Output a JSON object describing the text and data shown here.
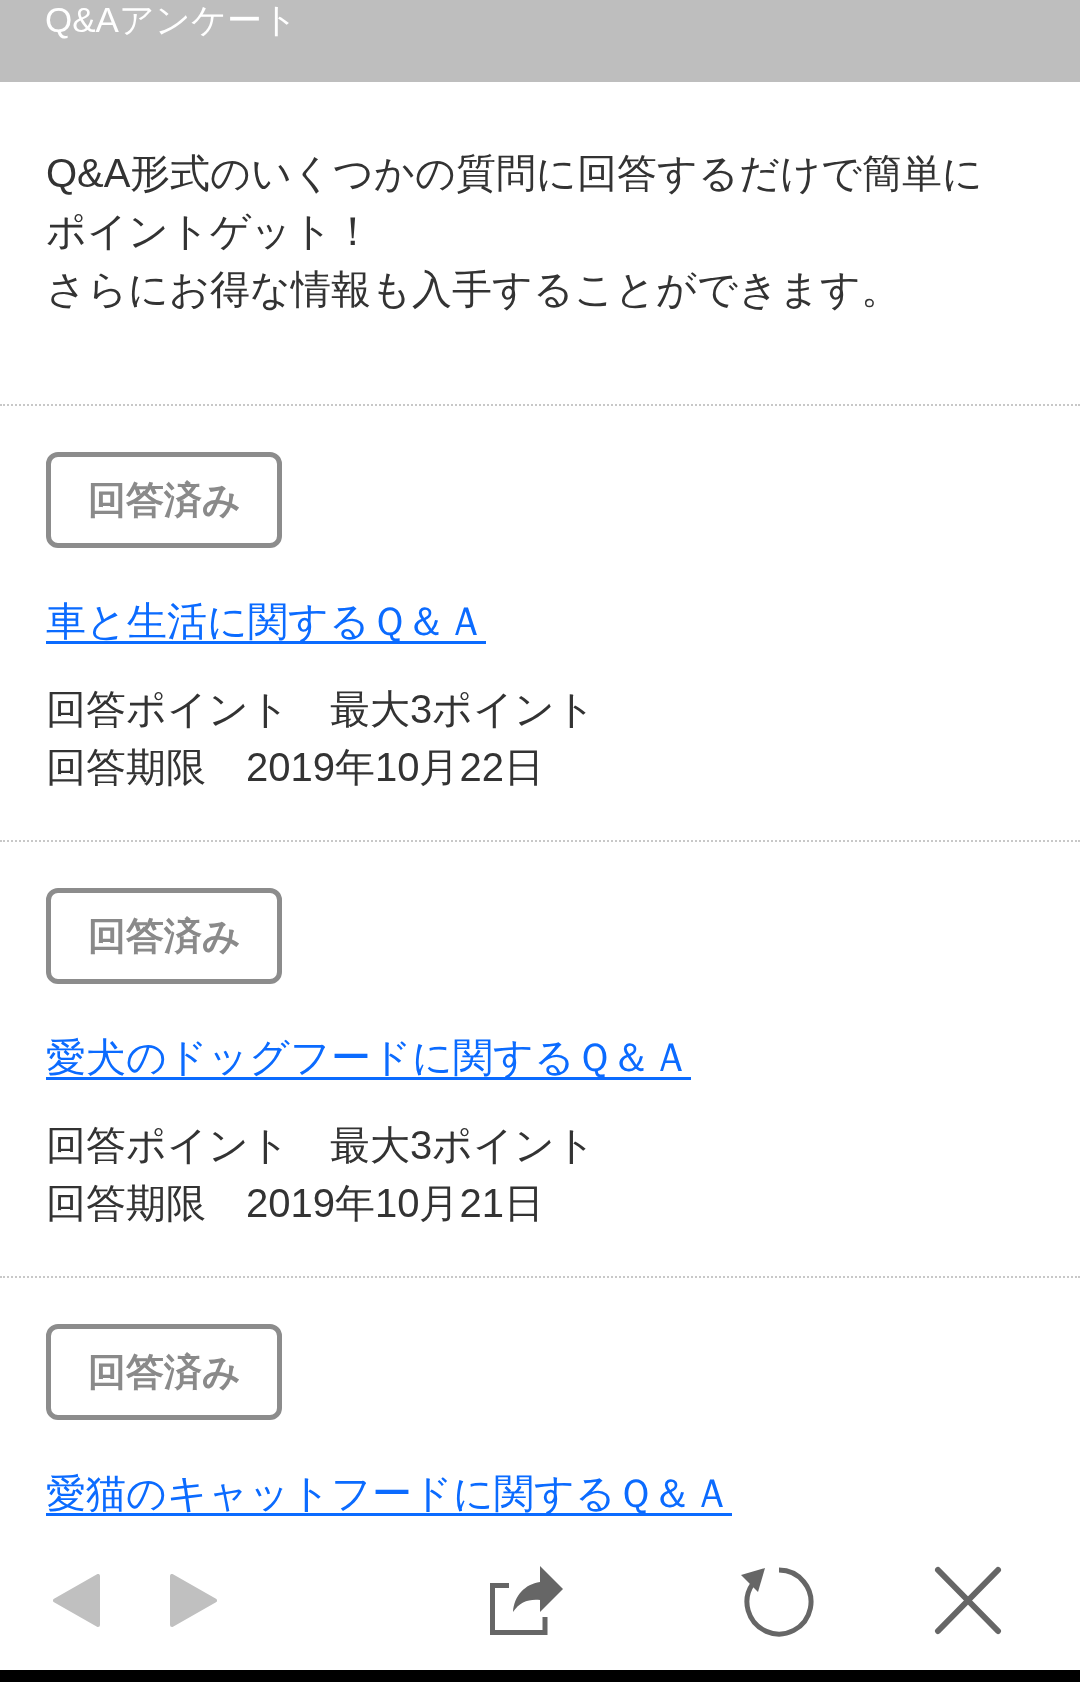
{
  "header": {
    "title": "Q&Aアンケート"
  },
  "intro": {
    "lines": [
      "Q&A形式のいくつかの質問に回答するだけで簡単に",
      "ポイントゲット！",
      "さらにお得な情報も入手することができます。"
    ]
  },
  "surveys": [
    {
      "badge": "回答済み",
      "title": "車と生活に関するＱ＆Ａ",
      "points": "回答ポイント　最大3ポイント",
      "deadline": "回答期限　2019年10月22日"
    },
    {
      "badge": "回答済み",
      "title": "愛犬のドッグフードに関するＱ＆Ａ",
      "points": "回答ポイント　最大3ポイント",
      "deadline": "回答期限　2019年10月21日"
    },
    {
      "badge": "回答済み",
      "title": "愛猫のキャットフードに関するＱ＆Ａ"
    }
  ],
  "toolbar": {
    "buttons": [
      {
        "kind": "back",
        "disabled": true
      },
      {
        "kind": "forward",
        "disabled": true
      },
      {
        "kind": "share",
        "disabled": false
      },
      {
        "kind": "reload",
        "disabled": false
      },
      {
        "kind": "close",
        "disabled": false
      }
    ]
  }
}
